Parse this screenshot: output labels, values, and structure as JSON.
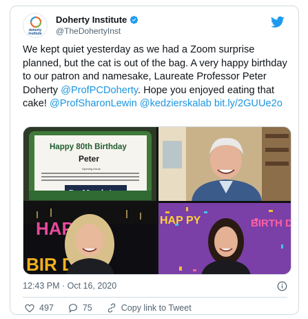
{
  "author": {
    "display_name": "Doherty Institute",
    "handle": "@TheDohertyInst",
    "avatar_text": "doherty institute"
  },
  "tweet": {
    "text_plain_1": "We kept quiet yesterday as we had a Zoom surprise planned, but the cat is out of the bag. A very happy birthday to our patron and namesake, Laureate Professor Peter Doherty ",
    "mention_1": "@ProfPCDoherty",
    "text_plain_2": ". Hope you enjoyed eating that cake! ",
    "mention_2": "@ProfSharonLewin",
    "text_plain_3": " ",
    "mention_3": "@kedzierskalab",
    "text_plain_4": " ",
    "link": "bit.ly/2GUUe2o"
  },
  "media": {
    "cake_line_1": "Happy 80th Birthday",
    "cake_line_2": "Peter",
    "cake_small": "Opening Hours",
    "cake_brand": "DanMurphy's",
    "banner_left_top": "HAP",
    "banner_left_bottom": "BIR  DAY",
    "banner_right_left": "HAP PY",
    "banner_right_right": "BIRTH DAY!"
  },
  "meta": {
    "timestamp": "12:43 PM · Oct 16, 2020"
  },
  "actions": {
    "likes": "497",
    "replies": "75",
    "copy_link": "Copy link to Tweet"
  },
  "colors": {
    "link": "#1b95e0",
    "twitter_blue": "#1d9bf0",
    "muted": "#536471",
    "border": "#cfd9de"
  }
}
